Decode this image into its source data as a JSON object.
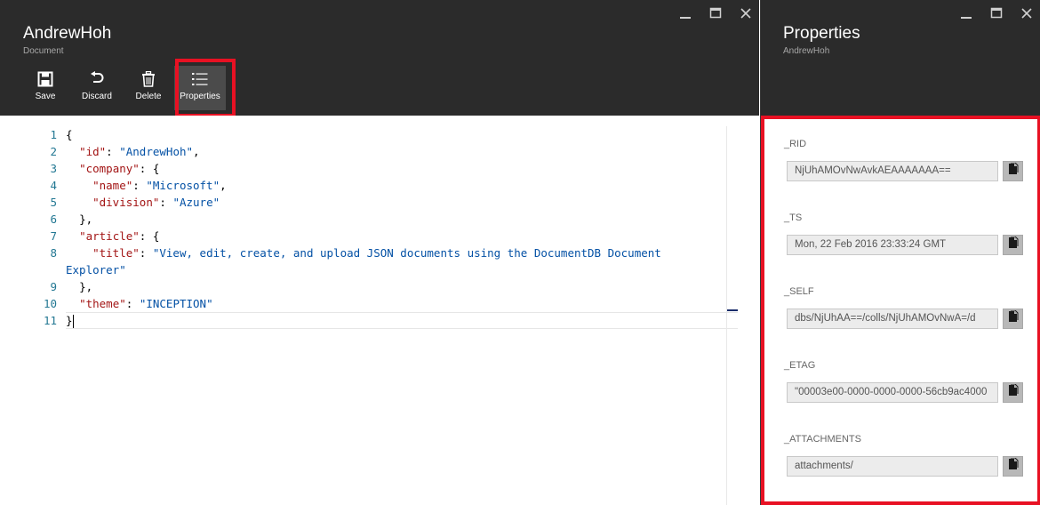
{
  "document_blade": {
    "title": "AndrewHoh",
    "subtitle": "Document",
    "toolbar": {
      "save": "Save",
      "discard": "Discard",
      "delete": "Delete",
      "properties": "Properties"
    }
  },
  "properties_blade": {
    "title": "Properties",
    "subtitle": "AndrewHoh",
    "fields": [
      {
        "label": "_RID",
        "value": "NjUhAMOvNwAvkAEAAAAAAA=="
      },
      {
        "label": "_TS",
        "value": "Mon, 22 Feb 2016 23:33:24 GMT"
      },
      {
        "label": "_SELF",
        "value": "dbs/NjUhAA==/colls/NjUhAMOvNwA=/d"
      },
      {
        "label": "_ETAG",
        "value": "\"00003e00-0000-0000-0000-56cb9ac4000"
      },
      {
        "label": "_ATTACHMENTS",
        "value": "attachments/"
      }
    ]
  },
  "editor": {
    "line_numbers": [
      "1",
      "2",
      "3",
      "4",
      "5",
      "6",
      "7",
      "8",
      "9",
      "10",
      "11"
    ],
    "lines": [
      {
        "indent": "",
        "key": "",
        "sep": "{",
        "val": "",
        "tail": ""
      },
      {
        "indent": "  ",
        "key": "\"id\"",
        "sep": ": ",
        "val": "\"AndrewHoh\"",
        "tail": ","
      },
      {
        "indent": "  ",
        "key": "\"company\"",
        "sep": ": {",
        "val": "",
        "tail": ""
      },
      {
        "indent": "    ",
        "key": "\"name\"",
        "sep": ": ",
        "val": "\"Microsoft\"",
        "tail": ","
      },
      {
        "indent": "    ",
        "key": "\"division\"",
        "sep": ": ",
        "val": "\"Azure\"",
        "tail": ""
      },
      {
        "indent": "  ",
        "key": "",
        "sep": "},",
        "val": "",
        "tail": ""
      },
      {
        "indent": "  ",
        "key": "\"article\"",
        "sep": ": {",
        "val": "",
        "tail": ""
      },
      {
        "indent": "    ",
        "key": "\"title\"",
        "sep": ": ",
        "val": "\"View, edit, create, and upload JSON documents using the DocumentDB Document",
        "tail": ""
      },
      {
        "indent": "",
        "key": "",
        "sep": "",
        "val": "Explorer\"",
        "tail": ""
      },
      {
        "indent": "  ",
        "key": "",
        "sep": "},",
        "val": "",
        "tail": ""
      },
      {
        "indent": "  ",
        "key": "\"theme\"",
        "sep": ": ",
        "val": "\"INCEPTION\"",
        "tail": ""
      },
      {
        "indent": "",
        "key": "",
        "sep": "}",
        "val": "",
        "tail": ""
      }
    ]
  },
  "colors": {
    "header_bg": "#2b2b2b",
    "highlight": "#e81123",
    "json_key": "#a31515",
    "json_string": "#0451a5",
    "line_number": "#237893"
  },
  "icons": [
    "minimize-icon",
    "maximize-icon",
    "close-icon",
    "save-icon",
    "discard-icon",
    "delete-icon",
    "properties-icon",
    "copy-icon"
  ]
}
